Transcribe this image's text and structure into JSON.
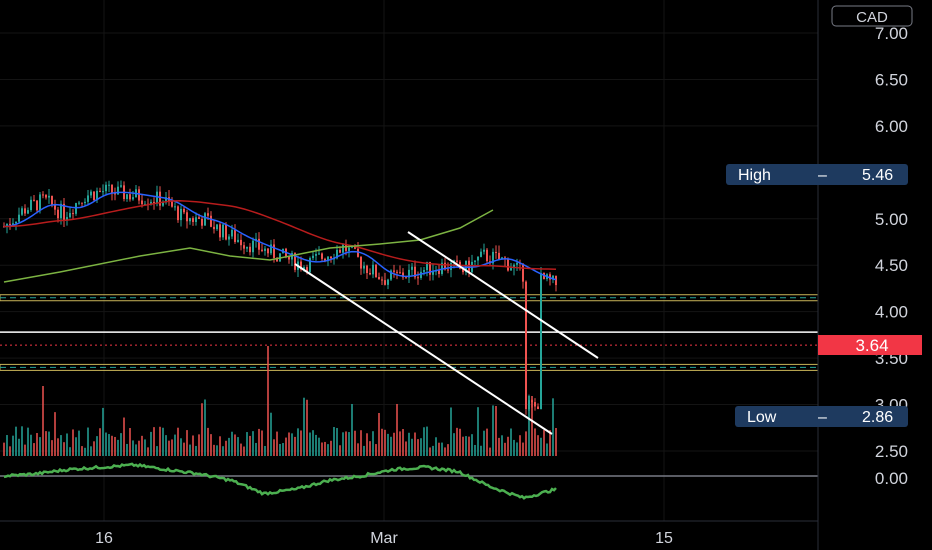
{
  "colors": {
    "background": "#000000",
    "grid": "#141414",
    "axis_text": "#d1d4dc",
    "candle_up": "#26a69a",
    "candle_down": "#ef5350",
    "ma_fast": "#2962ff",
    "ma_mid": "#b71c1c",
    "ma_slow": "#7cb342",
    "price_badge": "#f23645",
    "hl_badge": "#1e3a5f",
    "trendline": "#ffffff",
    "osc": "#4caf50"
  },
  "chart_data": {
    "type": "line",
    "currency_label": "CAD",
    "ylim": [
      2.4,
      7.2
    ],
    "y_ticks": [
      "7.00",
      "6.50",
      "6.00",
      "5.00",
      "4.50",
      "4.00",
      "3.50",
      "3.00",
      "2.50"
    ],
    "osc_tick": "0.00",
    "x_ticks": [
      "16",
      "Mar",
      "15"
    ],
    "x_tick_dates": [
      "2024-02-16",
      "2024-03-01",
      "2024-03-15"
    ],
    "last_price": {
      "label": "3.64",
      "value": 3.64
    },
    "high": {
      "label": "High",
      "value_label": "5.46",
      "value": 5.46
    },
    "low": {
      "label": "Low",
      "value_label": "2.86",
      "value": 2.86
    },
    "price_series": {
      "name": "",
      "x": [
        "2024-02-06",
        "2024-02-07",
        "2024-02-08",
        "2024-02-09",
        "2024-02-12",
        "2024-02-13",
        "2024-02-14",
        "2024-02-15",
        "2024-02-16",
        "2024-02-19",
        "2024-02-20",
        "2024-02-21",
        "2024-02-22",
        "2024-02-23",
        "2024-02-26",
        "2024-02-27",
        "2024-02-28",
        "2024-02-29",
        "2024-03-01",
        "2024-03-04",
        "2024-03-05",
        "2024-03-06",
        "2024-03-07",
        "2024-03-08",
        "2024-03-11",
        "2024-03-12"
      ],
      "values": [
        4.5,
        4.45,
        4.6,
        4.55,
        5.1,
        5.2,
        5.05,
        5.25,
        5.3,
        5.2,
        5.0,
        5.0,
        4.85,
        4.75,
        4.5,
        4.6,
        4.7,
        4.5,
        4.35,
        4.5,
        4.45,
        4.6,
        4.55,
        4.4,
        4.2,
        3.9
      ]
    },
    "horizontal_levels": [
      4.15,
      3.78,
      3.4
    ],
    "osc_series": {
      "name": "",
      "values": [
        0.0,
        0.1,
        0.3,
        0.4,
        0.5,
        0.3,
        0.1,
        -0.2,
        -0.8,
        -0.6,
        -0.2,
        0.0,
        0.3,
        0.4,
        0.2,
        -0.5,
        -1.0,
        -0.6
      ]
    }
  }
}
